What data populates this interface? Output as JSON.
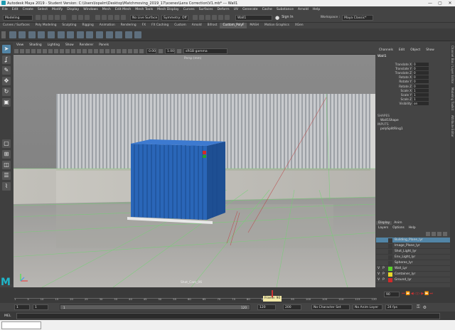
{
  "window": {
    "title": "Autodesk Maya 2019 - Student Version: C:\\Users\\lopalm\\Desktop\\Matchmoving_2019_17\\scenes\\Lens Correction\\V1.mb*  ---  Wall1",
    "controls": [
      "—",
      "▢",
      "✕"
    ]
  },
  "menubar": [
    "File",
    "Edit",
    "Create",
    "Select",
    "Modify",
    "Display",
    "Windows",
    "Mesh",
    "Edit Mesh",
    "Mesh Tools",
    "Mesh Display",
    "Curves",
    "Surfaces",
    "Deform",
    "UV",
    "Generate",
    "Cache",
    "Substance",
    "Arnold",
    "Help"
  ],
  "status": {
    "mode": "Modeling",
    "live_surface": "No Live Surface",
    "symmetry": "Symmetry: Off",
    "object_field": "Wall1",
    "workspace_label": "Workspace :",
    "workspace": "Maya Classic*",
    "sign_in": "Sign In"
  },
  "shelf_tabs": [
    "Curves / Surfaces",
    "Poly Modeling",
    "Sculpting",
    "Rigging",
    "Animation",
    "Rendering",
    "FX",
    "FX Caching",
    "Custom",
    "Arnold",
    "Bifrost",
    "Custom_PolyF",
    "MASH",
    "Motion Graphics",
    "XGen"
  ],
  "shelf_active": "Custom_PolyF",
  "viewport": {
    "menu": [
      "View",
      "Shading",
      "Lighting",
      "Show",
      "Renderer",
      "Panels"
    ],
    "gamma_value": "0.00",
    "exposure_value": "1.00",
    "color_space": "sRGB gamma",
    "camera_label": "Shot_Cam_06",
    "top_label": "Persp (mm)"
  },
  "channel_box": {
    "menu": [
      "Channels",
      "Edit",
      "Object",
      "Show"
    ],
    "object": "Wall1",
    "attributes": [
      {
        "name": "Translate X",
        "value": "0"
      },
      {
        "name": "Translate Y",
        "value": "0"
      },
      {
        "name": "Translate Z",
        "value": "0"
      },
      {
        "name": "Rotate X",
        "value": "0"
      },
      {
        "name": "Rotate Y",
        "value": "0"
      },
      {
        "name": "Rotate Z",
        "value": "0"
      },
      {
        "name": "Scale X",
        "value": "1"
      },
      {
        "name": "Scale Y",
        "value": "1"
      },
      {
        "name": "Scale Z",
        "value": "1"
      },
      {
        "name": "Visibility",
        "value": "on"
      }
    ],
    "shapes_header": "SHAPES",
    "shape": "Wall1Shape",
    "inputs_header": "INPUTS",
    "input": "polySplitRing1"
  },
  "layers": {
    "tabs": [
      "Display",
      "Anim"
    ],
    "menu": [
      "Layers",
      "Options",
      "Help"
    ],
    "items": [
      {
        "name": "Building_Plane_lyr",
        "v": "",
        "p": "",
        "color": "#3a3a3a"
      },
      {
        "name": "Image_Plane_lyr",
        "v": "",
        "p": "",
        "color": "#3a3a3a"
      },
      {
        "name": "Shot_Light_lyr",
        "v": "",
        "p": "",
        "color": "#3a3a3a"
      },
      {
        "name": "Env_Light_lyr",
        "v": "",
        "p": "",
        "color": "#3a3a3a"
      },
      {
        "name": "Spheres_lyr",
        "v": "",
        "p": "",
        "color": "#3a3a3a"
      },
      {
        "name": "Wall_Lyr",
        "v": "V",
        "p": "P",
        "color": "#5ad02a"
      },
      {
        "name": "Container_lyr",
        "v": "V",
        "p": "P",
        "color": "#e8d72a"
      },
      {
        "name": "Ground_lyr",
        "v": "V",
        "p": "P",
        "color": "#d02a2a"
      }
    ]
  },
  "side_strip": [
    "Channel Box / Layer Editor",
    "Modeling Toolkit",
    "Attribute Editor"
  ],
  "timeline": {
    "ticks": [
      "1",
      "5",
      "10",
      "15",
      "20",
      "25",
      "30",
      "35",
      "40",
      "45",
      "50",
      "55",
      "60",
      "65",
      "70",
      "75",
      "80",
      "85",
      "90",
      "95",
      "100",
      "105",
      "110",
      "115",
      "120"
    ],
    "current_frame_label": "Frame: 90",
    "current_frame": "90"
  },
  "range": {
    "start": "1",
    "inner_start": "1",
    "slider_start": "1",
    "slider_end": "120",
    "end": "120",
    "outer_end": "200",
    "character_set": "No Character Set",
    "anim_layer": "No Anim Layer",
    "fps": "24 fps"
  },
  "command_line": {
    "label": "MEL"
  }
}
